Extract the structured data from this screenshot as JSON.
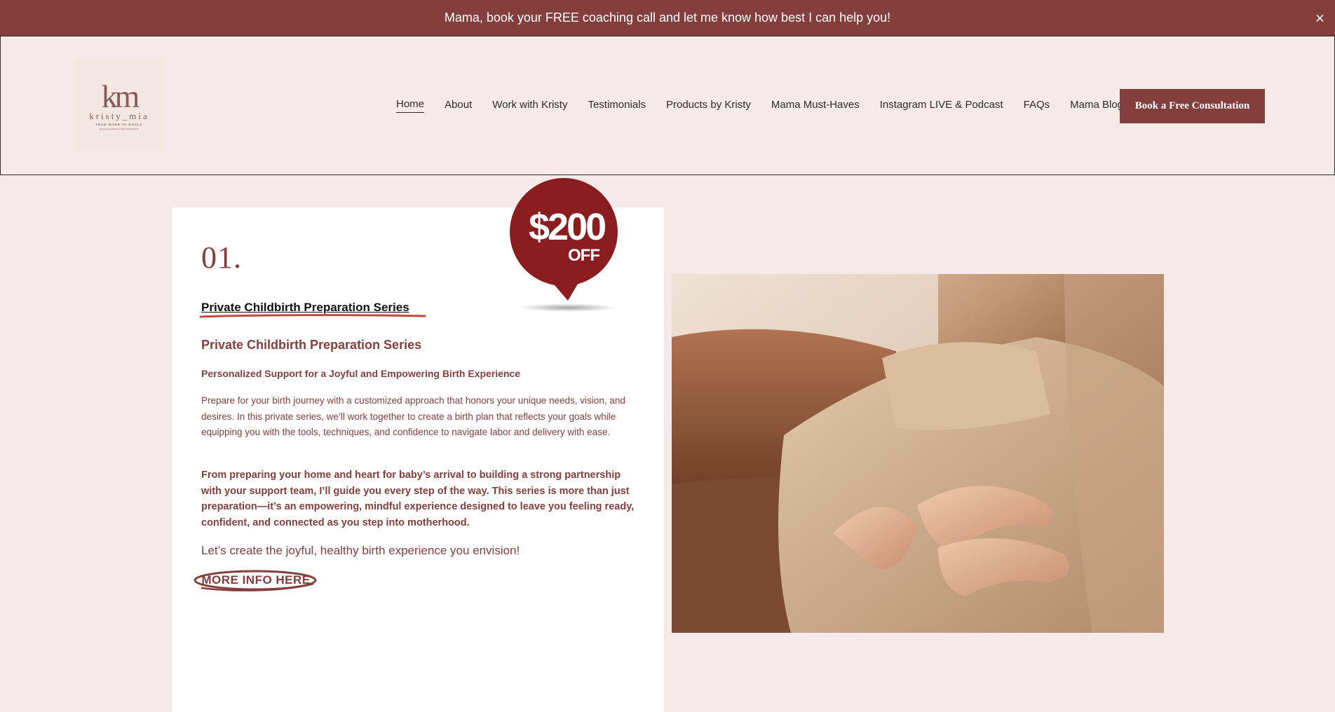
{
  "announcement": {
    "text": "Mama, book your FREE coaching call and let me know how best I can help you!",
    "close_label": "×"
  },
  "logo": {
    "mark": "km",
    "name": "kristy_mia",
    "tagline": "FROM WOMB TO WORLD",
    "subtitle": "Empowering Mamas in Birth & Postpartum"
  },
  "nav": {
    "items": [
      {
        "label": "Home",
        "active": true
      },
      {
        "label": "About"
      },
      {
        "label": "Work with Kristy"
      },
      {
        "label": "Testimonials"
      },
      {
        "label": "Products by Kristy"
      },
      {
        "label": "Mama Must-Haves"
      },
      {
        "label": "Instagram LIVE & Podcast"
      },
      {
        "label": "FAQs"
      },
      {
        "label": "Mama Blog"
      }
    ],
    "cta_label": "Book a Free Consultation"
  },
  "card": {
    "number": "01.",
    "link_title": "Private Childbirth Preparation Series",
    "heading": "Private Childbirth Preparation Series",
    "subheading": "Personalized Support for a Joyful and Empowering Birth Experience",
    "paragraph": "Prepare for your birth journey with a customized approach that honors your unique needs, vision, and desires. In this private series, we’ll work together to create a birth plan that reflects your goals while equipping you with the tools, techniques, and confidence to navigate labor and delivery with ease.",
    "bold_paragraph": "From preparing your home and heart for baby’s arrival to building a strong partnership with your support team, I’ll guide you every step of the way. This series is more than just preparation—it’s an empowering, mindful experience designed to leave you feeling ready, confident, and connected as you step into motherhood.",
    "closing": "Let’s create the joyful, healthy birth experience you envision!",
    "more_info_label": "MORE INFO HERE"
  },
  "badge": {
    "amount": "$200",
    "suffix": "OFF"
  },
  "colors": {
    "brand": "#843e3c",
    "background": "#f6e9e9",
    "badge": "#8b1c1f"
  }
}
